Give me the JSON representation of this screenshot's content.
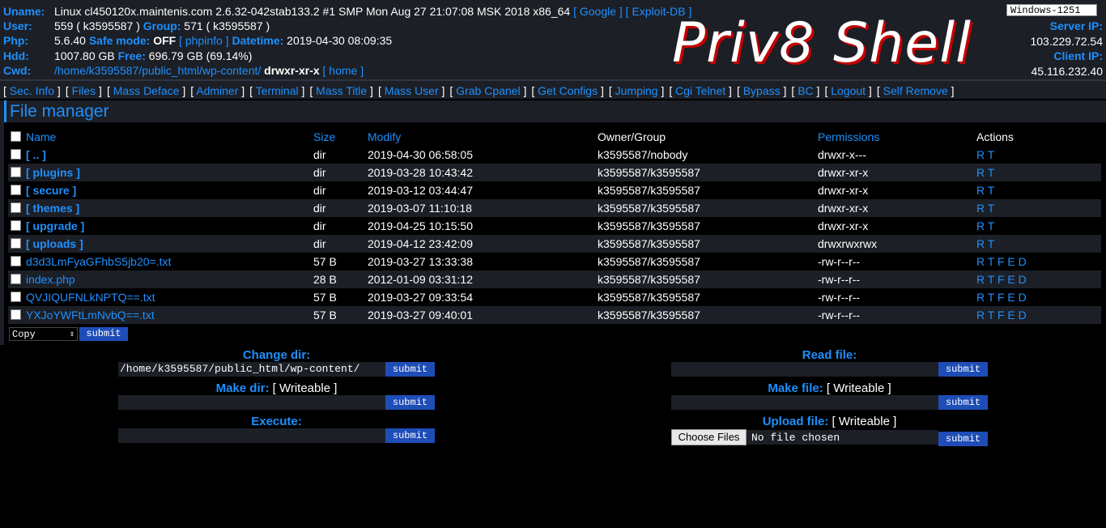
{
  "header": {
    "uname_label": "Uname:",
    "uname_value": "Linux cl450120x.maintenis.com 2.6.32-042stab133.2 #1 SMP Mon Aug 27 21:07:08 MSK 2018 x86_64",
    "google_link": "[ Google ]",
    "exploit_link": "[ Exploit-DB ]",
    "user_label": "User:",
    "user_value": "559 ( k3595587 )",
    "group_label": "Group:",
    "group_value": "571 ( k3595587 )",
    "php_label": "Php:",
    "php_value": "5.6.40",
    "safemode_label": "Safe mode:",
    "safemode_value": "OFF",
    "phpinfo_link": "[ phpinfo ]",
    "datetime_label": "Datetime:",
    "datetime_value": "2019-04-30 08:09:35",
    "hdd_label": "Hdd:",
    "hdd_value": "1007.80 GB",
    "free_label": "Free:",
    "free_value": "696.79 GB (69.14%)",
    "cwd_label": "Cwd:",
    "cwd_path": "/home/k3595587/public_html/wp-content/",
    "cwd_perm": "drwxr-xr-x",
    "home_link": "[ home ]",
    "logo": "Priv8 Shell",
    "charset": "Windows-1251",
    "server_ip_label": "Server IP:",
    "server_ip": "103.229.72.54",
    "client_ip_label": "Client IP:",
    "client_ip": "45.116.232.40"
  },
  "menu": [
    "Sec. Info",
    "Files",
    "Mass Deface",
    "Adminer",
    "Terminal",
    "Mass Title",
    "Mass User",
    "Grab Cpanel",
    "Get Configs",
    "Jumping",
    "Cgi Telnet",
    "Bypass",
    "BC",
    "Logout",
    "Self Remove"
  ],
  "file_manager": {
    "title": "File manager",
    "columns": {
      "name": "Name",
      "size": "Size",
      "modify": "Modify",
      "owner": "Owner/Group",
      "permissions": "Permissions",
      "actions": "Actions"
    },
    "rows": [
      {
        "name": "[ .. ]",
        "size": "dir",
        "modify": "2019-04-30 06:58:05",
        "owner": "k3595587/nobody",
        "perm": "drwxr-x---",
        "actions": "R T",
        "is_dir": true
      },
      {
        "name": "[ plugins ]",
        "size": "dir",
        "modify": "2019-03-28 10:43:42",
        "owner": "k3595587/k3595587",
        "perm": "drwxr-xr-x",
        "actions": "R T",
        "is_dir": true
      },
      {
        "name": "[ secure ]",
        "size": "dir",
        "modify": "2019-03-12 03:44:47",
        "owner": "k3595587/k3595587",
        "perm": "drwxr-xr-x",
        "actions": "R T",
        "is_dir": true
      },
      {
        "name": "[ themes ]",
        "size": "dir",
        "modify": "2019-03-07 11:10:18",
        "owner": "k3595587/k3595587",
        "perm": "drwxr-xr-x",
        "actions": "R T",
        "is_dir": true
      },
      {
        "name": "[ upgrade ]",
        "size": "dir",
        "modify": "2019-04-25 10:15:50",
        "owner": "k3595587/k3595587",
        "perm": "drwxr-xr-x",
        "actions": "R T",
        "is_dir": true
      },
      {
        "name": "[ uploads ]",
        "size": "dir",
        "modify": "2019-04-12 23:42:09",
        "owner": "k3595587/k3595587",
        "perm": "drwxrwxrwx",
        "actions": "R T",
        "is_dir": true
      },
      {
        "name": "d3d3LmFyaGFhbS5jb20=.txt",
        "size": "57 B",
        "modify": "2019-03-27 13:33:38",
        "owner": "k3595587/k3595587",
        "perm": "-rw-r--r--",
        "actions": "R T F E D",
        "is_dir": false
      },
      {
        "name": "index.php",
        "size": "28 B",
        "modify": "2012-01-09 03:31:12",
        "owner": "k3595587/k3595587",
        "perm": "-rw-r--r--",
        "actions": "R T F E D",
        "is_dir": false
      },
      {
        "name": "QVJIQUFNLkNPTQ==.txt",
        "size": "57 B",
        "modify": "2019-03-27 09:33:54",
        "owner": "k3595587/k3595587",
        "perm": "-rw-r--r--",
        "actions": "R T F E D",
        "is_dir": false
      },
      {
        "name": "YXJoYWFtLmNvbQ==.txt",
        "size": "57 B",
        "modify": "2019-03-27 09:40:01",
        "owner": "k3595587/k3595587",
        "perm": "-rw-r--r--",
        "actions": "R T F E D",
        "is_dir": false
      }
    ],
    "action_select": "Copy",
    "submit": "submit"
  },
  "forms": {
    "change_dir_label": "Change dir:",
    "change_dir_value": "/home/k3595587/public_html/wp-content/",
    "make_dir_label": "Make dir:",
    "make_dir_status": "[ Writeable ]",
    "execute_label": "Execute:",
    "read_file_label": "Read file:",
    "make_file_label": "Make file:",
    "make_file_status": "[ Writeable ]",
    "upload_file_label": "Upload file:",
    "upload_file_status": "[ Writeable ]",
    "choose_files": "Choose Files",
    "no_file": "No file chosen",
    "submit": "submit"
  }
}
